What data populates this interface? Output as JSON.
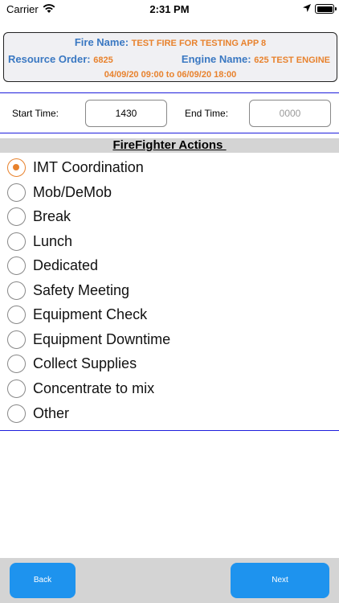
{
  "status_bar": {
    "carrier": "Carrier",
    "time": "2:31 PM",
    "icons": [
      "wifi-icon",
      "location-arrow-icon",
      "battery-icon"
    ]
  },
  "info": {
    "fire_name_label": "Fire Name:",
    "fire_name_value": "TEST FIRE FOR TESTING APP 8",
    "resource_order_label": "Resource Order:",
    "resource_order_value": "6825",
    "engine_name_label": "Engine Name:",
    "engine_name_value": "625 TEST ENGINE",
    "date_range": "04/09/20 09:00 to 06/09/20 18:00"
  },
  "times": {
    "start_label": "Start Time:",
    "start_value": "1430",
    "end_label": "End Time:",
    "end_placeholder": "0000"
  },
  "section": {
    "title": "FireFighter Actions "
  },
  "actions": [
    {
      "label": "IMT Coordination",
      "selected": true
    },
    {
      "label": "Mob/DeMob",
      "selected": false
    },
    {
      "label": "Break",
      "selected": false
    },
    {
      "label": "Lunch",
      "selected": false
    },
    {
      "label": "Dedicated",
      "selected": false
    },
    {
      "label": "Safety Meeting",
      "selected": false
    },
    {
      "label": "Equipment Check",
      "selected": false
    },
    {
      "label": "Equipment Downtime",
      "selected": false
    },
    {
      "label": "Collect Supplies",
      "selected": false
    },
    {
      "label": "Concentrate to mix",
      "selected": false
    },
    {
      "label": "Other",
      "selected": false
    }
  ],
  "footer": {
    "back_label": "Back",
    "next_label": "Next"
  },
  "colors": {
    "label_blue": "#3a78c2",
    "value_orange": "#e8822d",
    "button_blue": "#1e93ee",
    "rule_blue": "#1e1edc",
    "bar_gray": "#d4d4d4"
  }
}
